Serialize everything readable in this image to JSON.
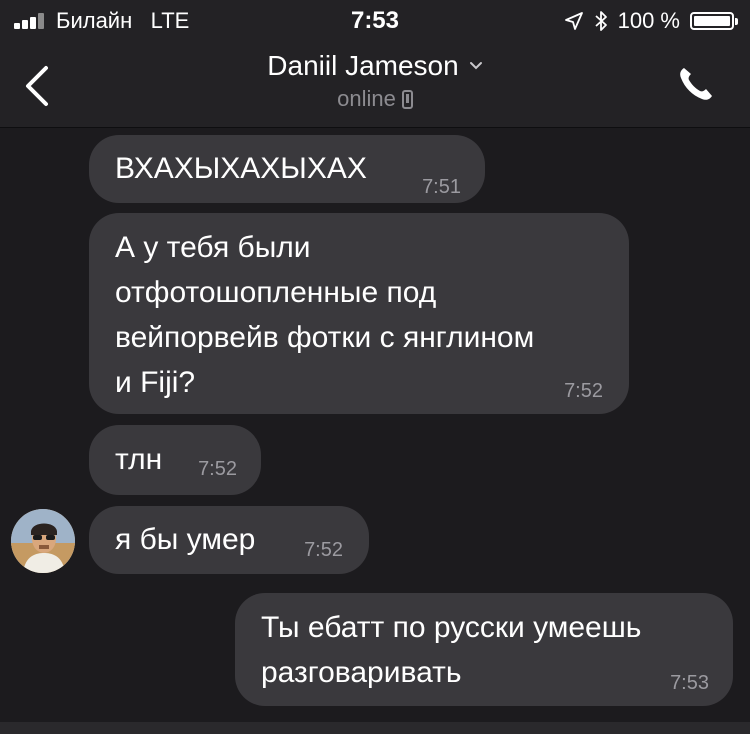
{
  "status_bar": {
    "carrier": "Билайн",
    "network": "LTE",
    "time": "7:53",
    "battery": "100 %",
    "battery_level": 1.0
  },
  "header": {
    "contact_name": "Daniil Jameson",
    "status": "online"
  },
  "messages": [
    {
      "text": "ВХАХЫХАХЫХАХ",
      "time": "7:51",
      "side": "incoming"
    },
    {
      "text": "А у тебя были\nотфотошопленные под\nвейпорвейв фотки с янглином\nи Fiji?",
      "time": "7:52",
      "side": "incoming"
    },
    {
      "text": "тлн",
      "time": "7:52",
      "side": "incoming"
    },
    {
      "text": "я бы умер",
      "time": "7:52",
      "side": "incoming"
    },
    {
      "text": "Ты ебатт по русски умеешь\nразговаривать",
      "time": "7:53",
      "side": "outgoing"
    }
  ],
  "colors": {
    "background": "#1c1b1e",
    "bubble": "#3a393d",
    "secondary_text": "#8c8b90"
  }
}
